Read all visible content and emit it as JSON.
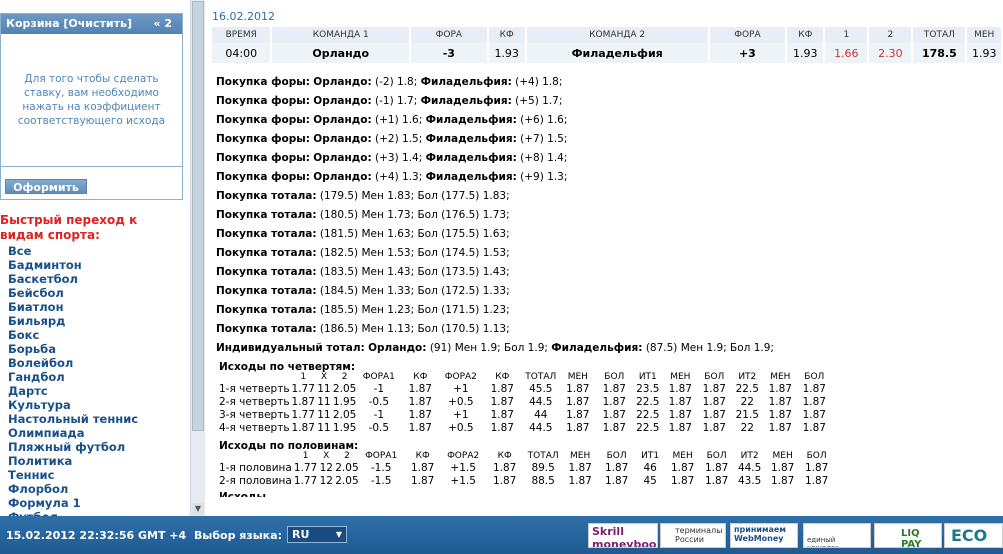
{
  "cart": {
    "title": "Корзина [Очистить]",
    "collapse": "« 2",
    "message": "Для того чтобы сделать ставку, вам необходимо нажать на коэффициент соответствующего исхода",
    "submit": "Оформить"
  },
  "quick_nav": {
    "title": "Быстрый переход к видам спорта:",
    "sports": [
      "Все",
      "Бадминтон",
      "Баскетбол",
      "Бейсбол",
      "Биатлон",
      "Бильярд",
      "Бокс",
      "Борьба",
      "Волейбол",
      "Гандбол",
      "Дартс",
      "Культура",
      "Настольный теннис",
      "Олимпиада",
      "Пляжный футбол",
      "Политика",
      "Теннис",
      "Флорбол",
      "Формула 1",
      "Футбол"
    ]
  },
  "event": {
    "date": "16.02.2012",
    "headers": [
      "ВРЕМЯ",
      "КОМАНДА 1",
      "ФОРА",
      "КФ",
      "КОМАНДА 2",
      "ФОРА",
      "КФ",
      "1",
      "2",
      "ТОТАЛ",
      "МЕН"
    ],
    "row": [
      "04:00",
      "Орландо",
      "-3",
      "1.93",
      "Филадельфия",
      "+3",
      "1.93",
      "1.66",
      "2.30",
      "178.5",
      "1.93"
    ]
  },
  "lines": [
    {
      "label": "Покупка форы:",
      "t1": "Орландо:",
      "v1": "(-2) 1.8;",
      "t2": "Филадельфия:",
      "v2": "(+4) 1.8;"
    },
    {
      "label": "Покупка форы:",
      "t1": "Орландо:",
      "v1": "(-1) 1.7;",
      "t2": "Филадельфия:",
      "v2": "(+5) 1.7;"
    },
    {
      "label": "Покупка форы:",
      "t1": "Орландо:",
      "v1": "(+1) 1.6;",
      "t2": "Филадельфия:",
      "v2": "(+6) 1.6;"
    },
    {
      "label": "Покупка форы:",
      "t1": "Орландо:",
      "v1": "(+2) 1.5;",
      "t2": "Филадельфия:",
      "v2": "(+7) 1.5;"
    },
    {
      "label": "Покупка форы:",
      "t1": "Орландо:",
      "v1": "(+3) 1.4;",
      "t2": "Филадельфия:",
      "v2": "(+8) 1.4;"
    },
    {
      "label": "Покупка форы:",
      "t1": "Орландо:",
      "v1": "(+4) 1.3;",
      "t2": "Филадельфия:",
      "v2": "(+9) 1.3;"
    },
    {
      "label": "Покупка тотала:",
      "t1": "",
      "v1": "(179.5) Мен 1.83; Бол (177.5) 1.83;",
      "t2": "",
      "v2": ""
    },
    {
      "label": "Покупка тотала:",
      "t1": "",
      "v1": "(180.5) Мен 1.73; Бол (176.5) 1.73;",
      "t2": "",
      "v2": ""
    },
    {
      "label": "Покупка тотала:",
      "t1": "",
      "v1": "(181.5) Мен 1.63; Бол (175.5) 1.63;",
      "t2": "",
      "v2": ""
    },
    {
      "label": "Покупка тотала:",
      "t1": "",
      "v1": "(182.5) Мен 1.53; Бол (174.5) 1.53;",
      "t2": "",
      "v2": ""
    },
    {
      "label": "Покупка тотала:",
      "t1": "",
      "v1": "(183.5) Мен 1.43; Бол (173.5) 1.43;",
      "t2": "",
      "v2": ""
    },
    {
      "label": "Покупка тотала:",
      "t1": "",
      "v1": "(184.5) Мен 1.33; Бол (172.5) 1.33;",
      "t2": "",
      "v2": ""
    },
    {
      "label": "Покупка тотала:",
      "t1": "",
      "v1": "(185.5) Мен 1.23; Бол (171.5) 1.23;",
      "t2": "",
      "v2": ""
    },
    {
      "label": "Покупка тотала:",
      "t1": "",
      "v1": "(186.5) Мен 1.13; Бол (170.5) 1.13;",
      "t2": "",
      "v2": ""
    },
    {
      "label": "Индивидуальный тотал:",
      "t1": "Орландо:",
      "v1": "(91) Мен 1.9; Бол 1.9;",
      "t2": "Филадельфия:",
      "v2": "(87.5) Мен 1.9; Бол 1.9;"
    }
  ],
  "quarters": {
    "title": "Исходы по четвертям:",
    "headers": [
      "",
      "1",
      "X",
      "2",
      "ФОРА1",
      "КФ",
      "ФОРА2",
      "КФ",
      "ТОТАЛ",
      "МЕН",
      "БОЛ",
      "ИТ1",
      "МЕН",
      "БОЛ",
      "ИТ2",
      "МЕН",
      "БОЛ"
    ],
    "rows": [
      [
        "1-я четверть",
        "1.77",
        "11",
        "2.05",
        "-1",
        "1.87",
        "+1",
        "1.87",
        "45.5",
        "1.87",
        "1.87",
        "23.5",
        "1.87",
        "1.87",
        "22.5",
        "1.87",
        "1.87"
      ],
      [
        "2-я четверть",
        "1.87",
        "11",
        "1.95",
        "-0.5",
        "1.87",
        "+0.5",
        "1.87",
        "44.5",
        "1.87",
        "1.87",
        "22.5",
        "1.87",
        "1.87",
        "22",
        "1.87",
        "1.87"
      ],
      [
        "3-я четверть",
        "1.77",
        "11",
        "2.05",
        "-1",
        "1.87",
        "+1",
        "1.87",
        "44",
        "1.87",
        "1.87",
        "22.5",
        "1.87",
        "1.87",
        "21.5",
        "1.87",
        "1.87"
      ],
      [
        "4-я четверть",
        "1.87",
        "11",
        "1.95",
        "-0.5",
        "1.87",
        "+0.5",
        "1.87",
        "44.5",
        "1.87",
        "1.87",
        "22.5",
        "1.87",
        "1.87",
        "22",
        "1.87",
        "1.87"
      ]
    ]
  },
  "halves": {
    "title": "Исходы по половинам:",
    "headers": [
      "",
      "1",
      "X",
      "2",
      "ФОРА1",
      "КФ",
      "ФОРА2",
      "КФ",
      "ТОТАЛ",
      "МЕН",
      "БОЛ",
      "ИТ1",
      "МЕН",
      "БОЛ",
      "ИТ2",
      "МЕН",
      "БОЛ"
    ],
    "rows": [
      [
        "1-я половина",
        "1.77",
        "12",
        "2.05",
        "-1.5",
        "1.87",
        "+1.5",
        "1.87",
        "89.5",
        "1.87",
        "1.87",
        "46",
        "1.87",
        "1.87",
        "44.5",
        "1.87",
        "1.87"
      ],
      [
        "2-я половина",
        "1.77",
        "12",
        "2.05",
        "-1.5",
        "1.87",
        "+1.5",
        "1.87",
        "88.5",
        "1.87",
        "1.87",
        "45",
        "1.87",
        "1.87",
        "43.5",
        "1.87",
        "1.87"
      ]
    ]
  },
  "cutoff_text": "Исходы",
  "footer": {
    "datetime": "15.02.2012   22:32:56   GMT +4",
    "lang_label": "Выбор языка:",
    "lang_value": "RU",
    "logos": [
      "Skrill moneybookers",
      "терминалы России",
      "принимаем WebMoney",
      "единый кошелек",
      "LIQ PAY",
      "ECO"
    ]
  }
}
